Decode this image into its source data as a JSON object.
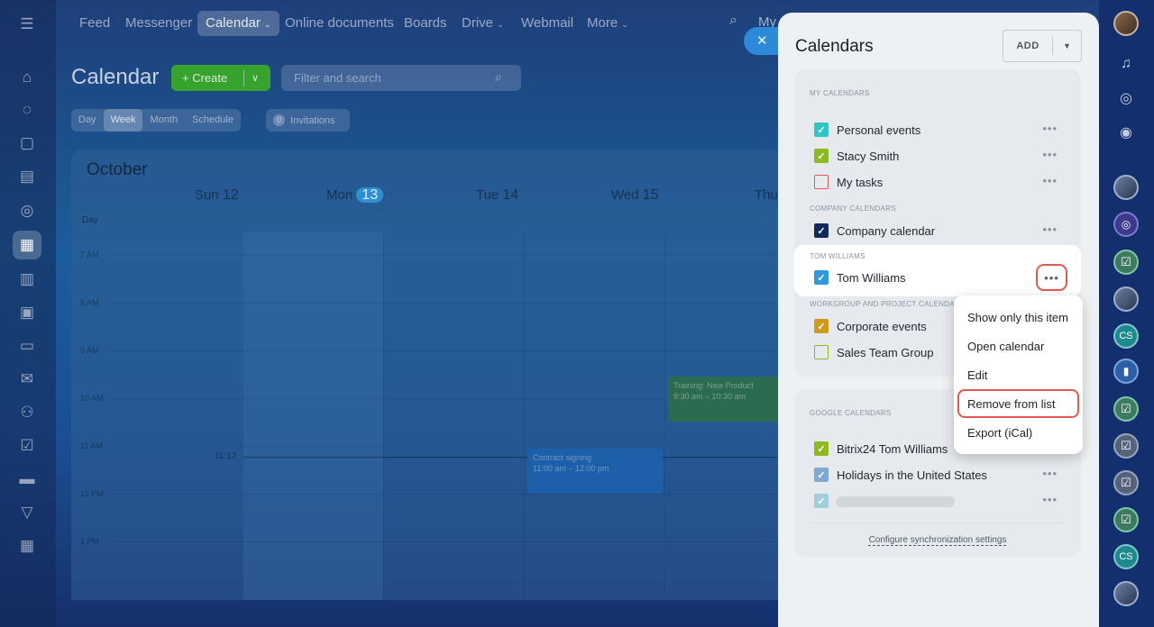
{
  "top_nav": {
    "items": [
      "Feed",
      "Messenger",
      "Calendar",
      "Online documents",
      "Boards",
      "Drive",
      "Webmail",
      "More"
    ],
    "partial_text": "My"
  },
  "calendar": {
    "title": "Calendar",
    "create_label": "Create",
    "filter_placeholder": "Filter and search",
    "views": [
      "Day",
      "Week",
      "Month",
      "Schedule"
    ],
    "active_view": "Week",
    "invitations_count": "0",
    "invitations_label": "Invitations",
    "month": "October",
    "days": [
      {
        "name": "Sun",
        "num": "12"
      },
      {
        "name": "Mon",
        "num": "13"
      },
      {
        "name": "Tue",
        "num": "14"
      },
      {
        "name": "Wed",
        "num": "15"
      },
      {
        "name": "Thu",
        "num": ""
      }
    ],
    "day_label": "Day",
    "hours": [
      "7 AM",
      "8 AM",
      "9 AM",
      "10 AM",
      "11 AM",
      "12 PM",
      "1 PM"
    ],
    "now_time": "11:12",
    "events": [
      {
        "title": "Contract signing",
        "time": "11:00 am – 12:00 pm"
      },
      {
        "title": "Training: New Product",
        "time": "9:30 am – 10:30 am"
      }
    ]
  },
  "panel": {
    "title": "Calendars",
    "add_label": "ADD",
    "sections": {
      "my": "MY CALENDARS",
      "company": "COMPANY CALENDARS",
      "tom": "TOM WILLIAMS",
      "workgroup": "WORKGROUP AND PROJECT CALENDARS",
      "google": "GOOGLE CALENDARS"
    },
    "my_calendars": [
      {
        "name": "Personal events",
        "color": "#2fc6c6",
        "checked": true
      },
      {
        "name": "Stacy Smith",
        "color": "#8cba1f",
        "checked": true
      },
      {
        "name": "My tasks",
        "color": "#e5595b",
        "checked": false
      }
    ],
    "company_calendars": [
      {
        "name": "Company calendar",
        "color": "#0f2a5c",
        "checked": true
      }
    ],
    "tom_calendars": [
      {
        "name": "Tom Williams",
        "color": "#2d9ae0",
        "checked": true
      }
    ],
    "workgroup_calendars": [
      {
        "name": "Corporate events",
        "color": "#d29a1a",
        "checked": true
      },
      {
        "name": "Sales Team Group",
        "color": "#8cba1f",
        "checked": false
      }
    ],
    "google_calendars": [
      {
        "name": "Bitrix24 Tom Williams",
        "color": "#8cba1f",
        "checked": true
      },
      {
        "name": "Holidays in the United States",
        "color": "#7fa9d1",
        "checked": true
      },
      {
        "name": "",
        "color": "#9ecfe0",
        "checked": true
      }
    ],
    "sync_link": "Configure synchronization settings",
    "context_menu": [
      "Show only this item",
      "Open calendar",
      "Edit",
      "Remove from list",
      "Export (iCal)"
    ]
  },
  "right_bar": {
    "cs_label": "CS"
  }
}
